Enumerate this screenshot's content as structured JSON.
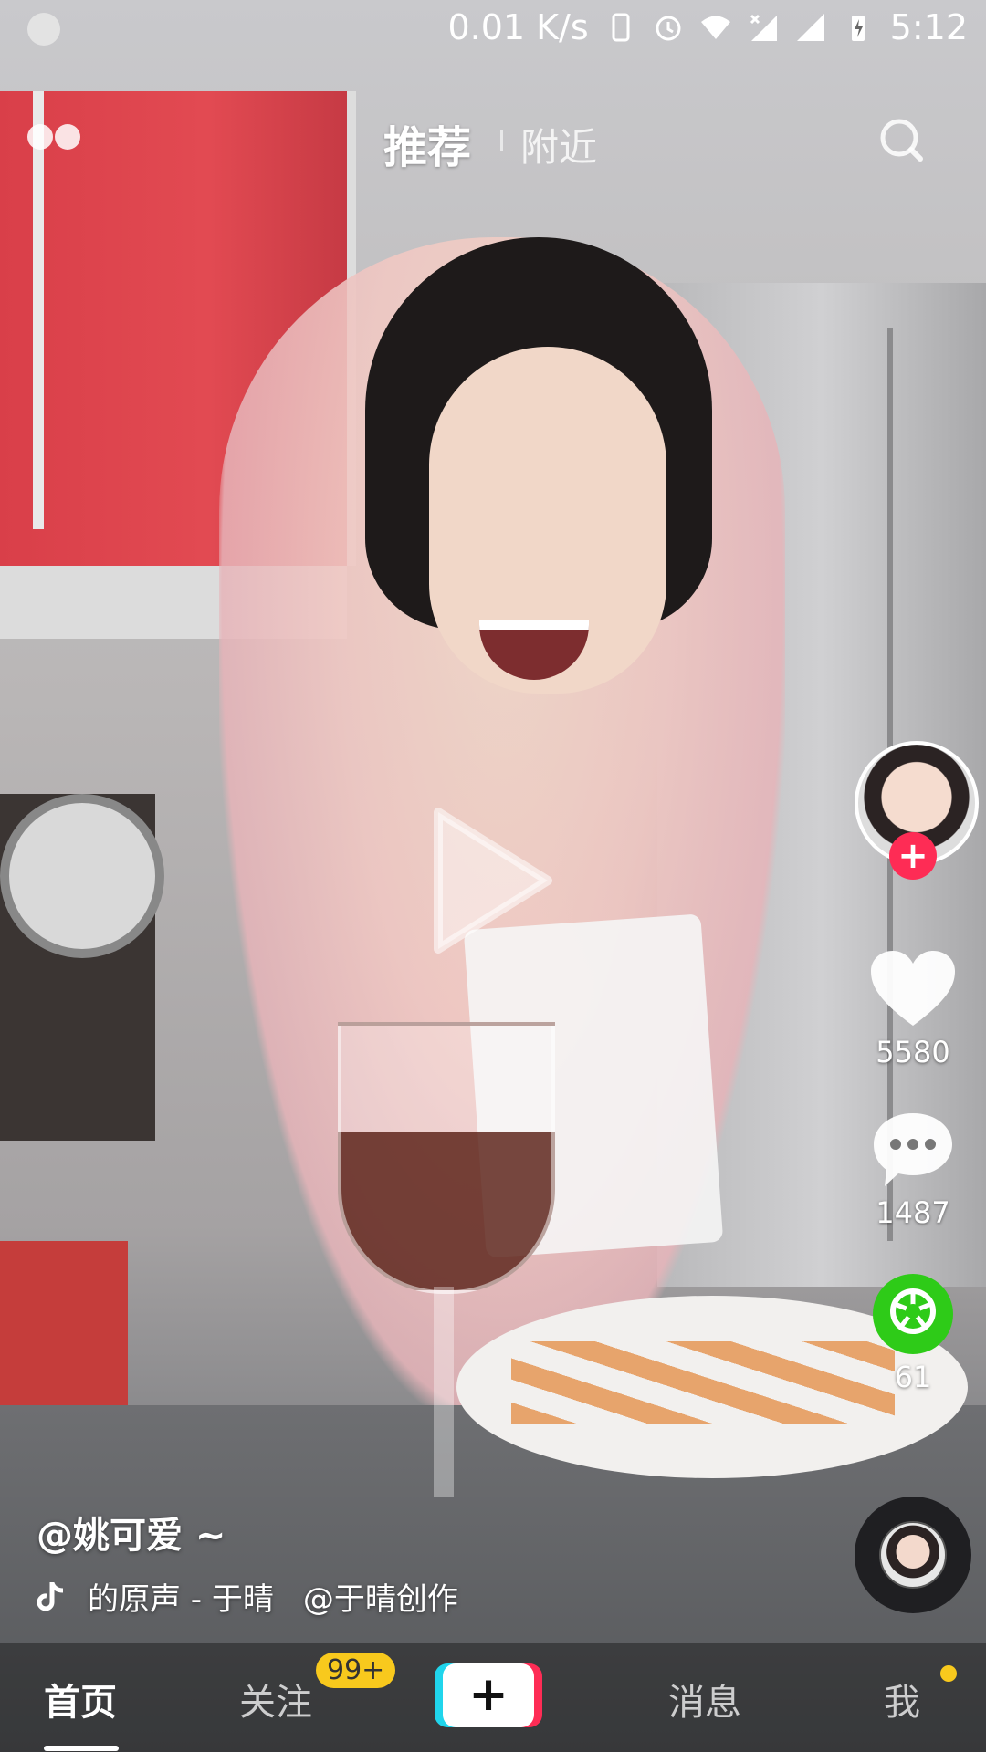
{
  "status_bar": {
    "speed": "0.01 K/s",
    "time": "5:12",
    "icons": [
      "loading-icon",
      "phone-icon",
      "alarm-icon",
      "wifi-icon",
      "signal-x-icon",
      "signal-icon",
      "battery-charging-icon"
    ]
  },
  "top_tabs": {
    "recommend": "推荐",
    "nearby": "附近"
  },
  "actions": {
    "likes": "5580",
    "comments": "1487",
    "shares": "61"
  },
  "caption": {
    "author": "@姚可爱 ~",
    "music": "的原声 - 于晴",
    "music_credit": "@于晴创作"
  },
  "bottom_nav": {
    "home": "首页",
    "follow": "关注",
    "follow_badge": "99+",
    "add": "+",
    "messages": "消息",
    "me": "我"
  },
  "colors": {
    "accent_red": "#fe2c55",
    "accent_cyan": "#20d5ec",
    "share_green": "#2ecb18",
    "badge_yellow": "#f8c91d"
  }
}
